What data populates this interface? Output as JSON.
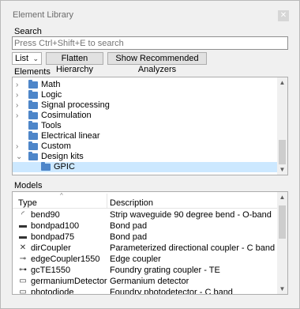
{
  "window": {
    "title": "Element Library",
    "close_glyph": "✕"
  },
  "search": {
    "label": "Search",
    "placeholder": "Press Ctrl+Shift+E to search"
  },
  "toolbar": {
    "view_select": "List",
    "flatten_label": "Flatten Hierarchy",
    "analyzers_label": "Show Recommended Analyzers"
  },
  "elements": {
    "label": "Elements",
    "items": [
      {
        "label": "Math",
        "expanded": false
      },
      {
        "label": "Logic",
        "expanded": false
      },
      {
        "label": "Signal processing",
        "expanded": false
      },
      {
        "label": "Cosimulation",
        "expanded": false
      },
      {
        "label": "Tools",
        "expanded": false
      },
      {
        "label": "Electrical linear",
        "expanded": false
      },
      {
        "label": "Custom",
        "expanded": false
      },
      {
        "label": "Design kits",
        "expanded": true
      },
      {
        "label": "GPIC",
        "child": true,
        "selected": true
      }
    ]
  },
  "models": {
    "label": "Models",
    "columns": {
      "type": "Type",
      "description": "Description"
    },
    "rows": [
      {
        "icon": "waveguide-bend-icon",
        "name": "bend90",
        "description": "Strip waveguide 90 degree bend - O-band"
      },
      {
        "icon": "bond-pad-icon",
        "name": "bondpad100",
        "description": "Bond pad"
      },
      {
        "icon": "bond-pad-icon",
        "name": "bondpad75",
        "description": "Bond pad"
      },
      {
        "icon": "directional-coupler-icon",
        "name": "dirCoupler",
        "description": "Parameterized directional coupler - C band"
      },
      {
        "icon": "edge-coupler-icon",
        "name": "edgeCoupler1550",
        "description": "Edge coupler"
      },
      {
        "icon": "grating-coupler-icon",
        "name": "gcTE1550",
        "description": "Foundry grating coupler - TE"
      },
      {
        "icon": "photodetector-icon",
        "name": "germaniumDetector",
        "description": "Germanium detector"
      },
      {
        "icon": "photodiode-icon",
        "name": "photodiode",
        "description": "Foundry photodetector - C band"
      }
    ]
  }
}
